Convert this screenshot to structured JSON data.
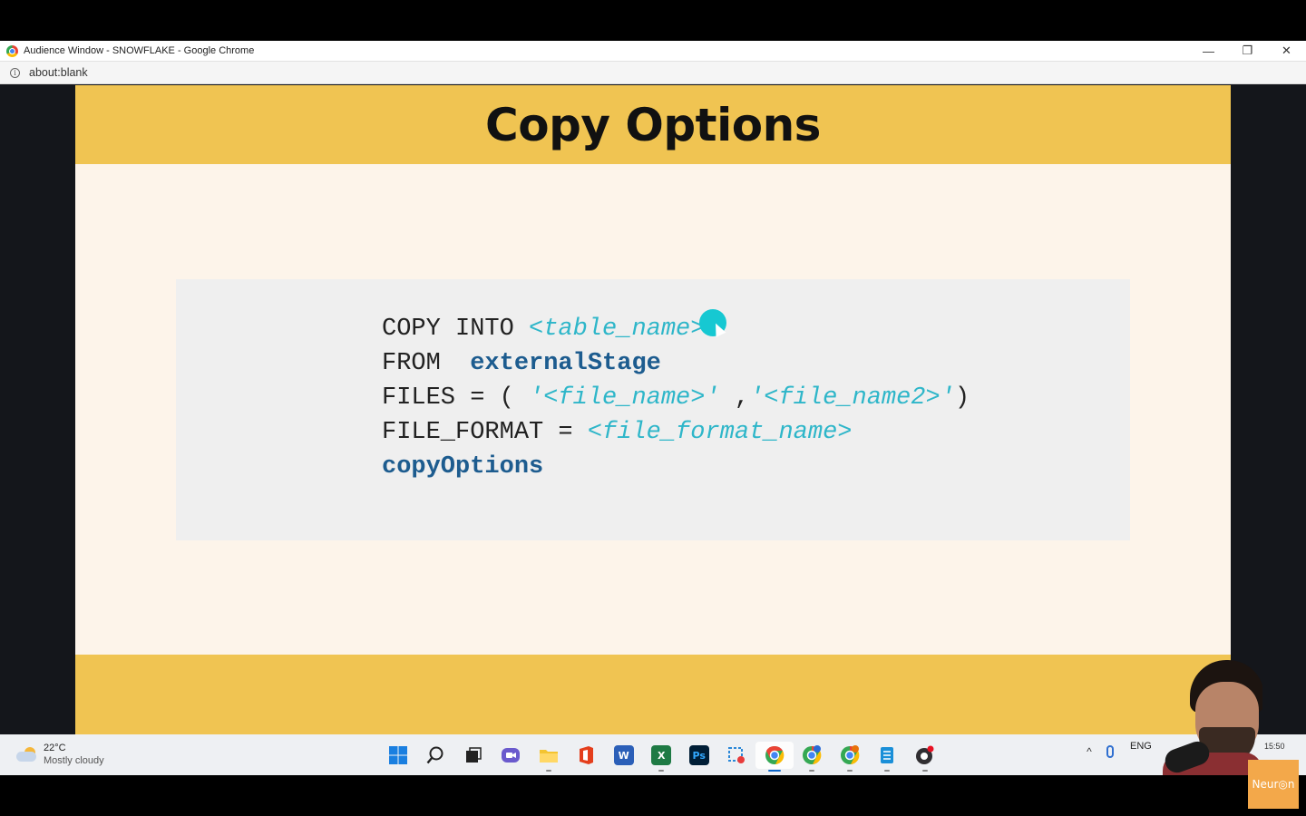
{
  "window": {
    "title": "Audience Window - SNOWFLAKE - Google Chrome",
    "controls": {
      "minimize": "—",
      "restore": "❐",
      "close": "✕"
    }
  },
  "address_bar": {
    "url": "about:blank",
    "info_icon": "info-icon"
  },
  "slide": {
    "title": "Copy Options",
    "code": {
      "line1_kw": "COPY INTO ",
      "line1_ph": "<table_name>",
      "line2_kw": "FROM  ",
      "line2_bold": "externalStage",
      "line3_kw": "FILES = ( ",
      "line3_ph1": "'<file_name>'",
      "line3_mid": " ,",
      "line3_ph2": "'<file_name2>'",
      "line3_end": ")",
      "line4_kw": "FILE_FORMAT = ",
      "line4_ph": "<file_format_name>",
      "line5_bold": "copyOptions"
    },
    "colors": {
      "header": "#f0c452",
      "body": "#fdf4ea",
      "code_bg": "#efefef",
      "keyword": "#1d5c8f",
      "placeholder": "#2eb6c9"
    }
  },
  "taskbar": {
    "weather": {
      "temp": "22°C",
      "desc": "Mostly cloudy",
      "icon": "partly-cloudy-icon"
    },
    "apps": [
      {
        "name": "start",
        "icon": "windows-start-icon"
      },
      {
        "name": "search",
        "icon": "search-icon"
      },
      {
        "name": "task-view",
        "icon": "task-view-icon"
      },
      {
        "name": "chat",
        "icon": "teams-chat-icon"
      },
      {
        "name": "file-explorer",
        "icon": "folder-icon"
      },
      {
        "name": "office",
        "icon": "office-icon"
      },
      {
        "name": "word",
        "icon": "word-icon",
        "glyph": "W"
      },
      {
        "name": "excel",
        "icon": "excel-icon",
        "glyph": "X"
      },
      {
        "name": "photoshop",
        "icon": "photoshop-icon",
        "glyph": "Ps"
      },
      {
        "name": "snipping-tool",
        "icon": "snipping-tool-icon"
      },
      {
        "name": "chrome",
        "icon": "chrome-icon"
      },
      {
        "name": "chrome-profile-2",
        "icon": "chrome-profile-icon"
      },
      {
        "name": "chrome-profile-3",
        "icon": "chrome-profile-icon"
      },
      {
        "name": "notepad",
        "icon": "notepad-icon"
      },
      {
        "name": "obs",
        "icon": "obs-record-icon"
      }
    ],
    "tray": {
      "chevron": "^",
      "lang": "ENG",
      "clock": "15:50"
    }
  },
  "overlay": {
    "badge": "Neur◎n"
  }
}
